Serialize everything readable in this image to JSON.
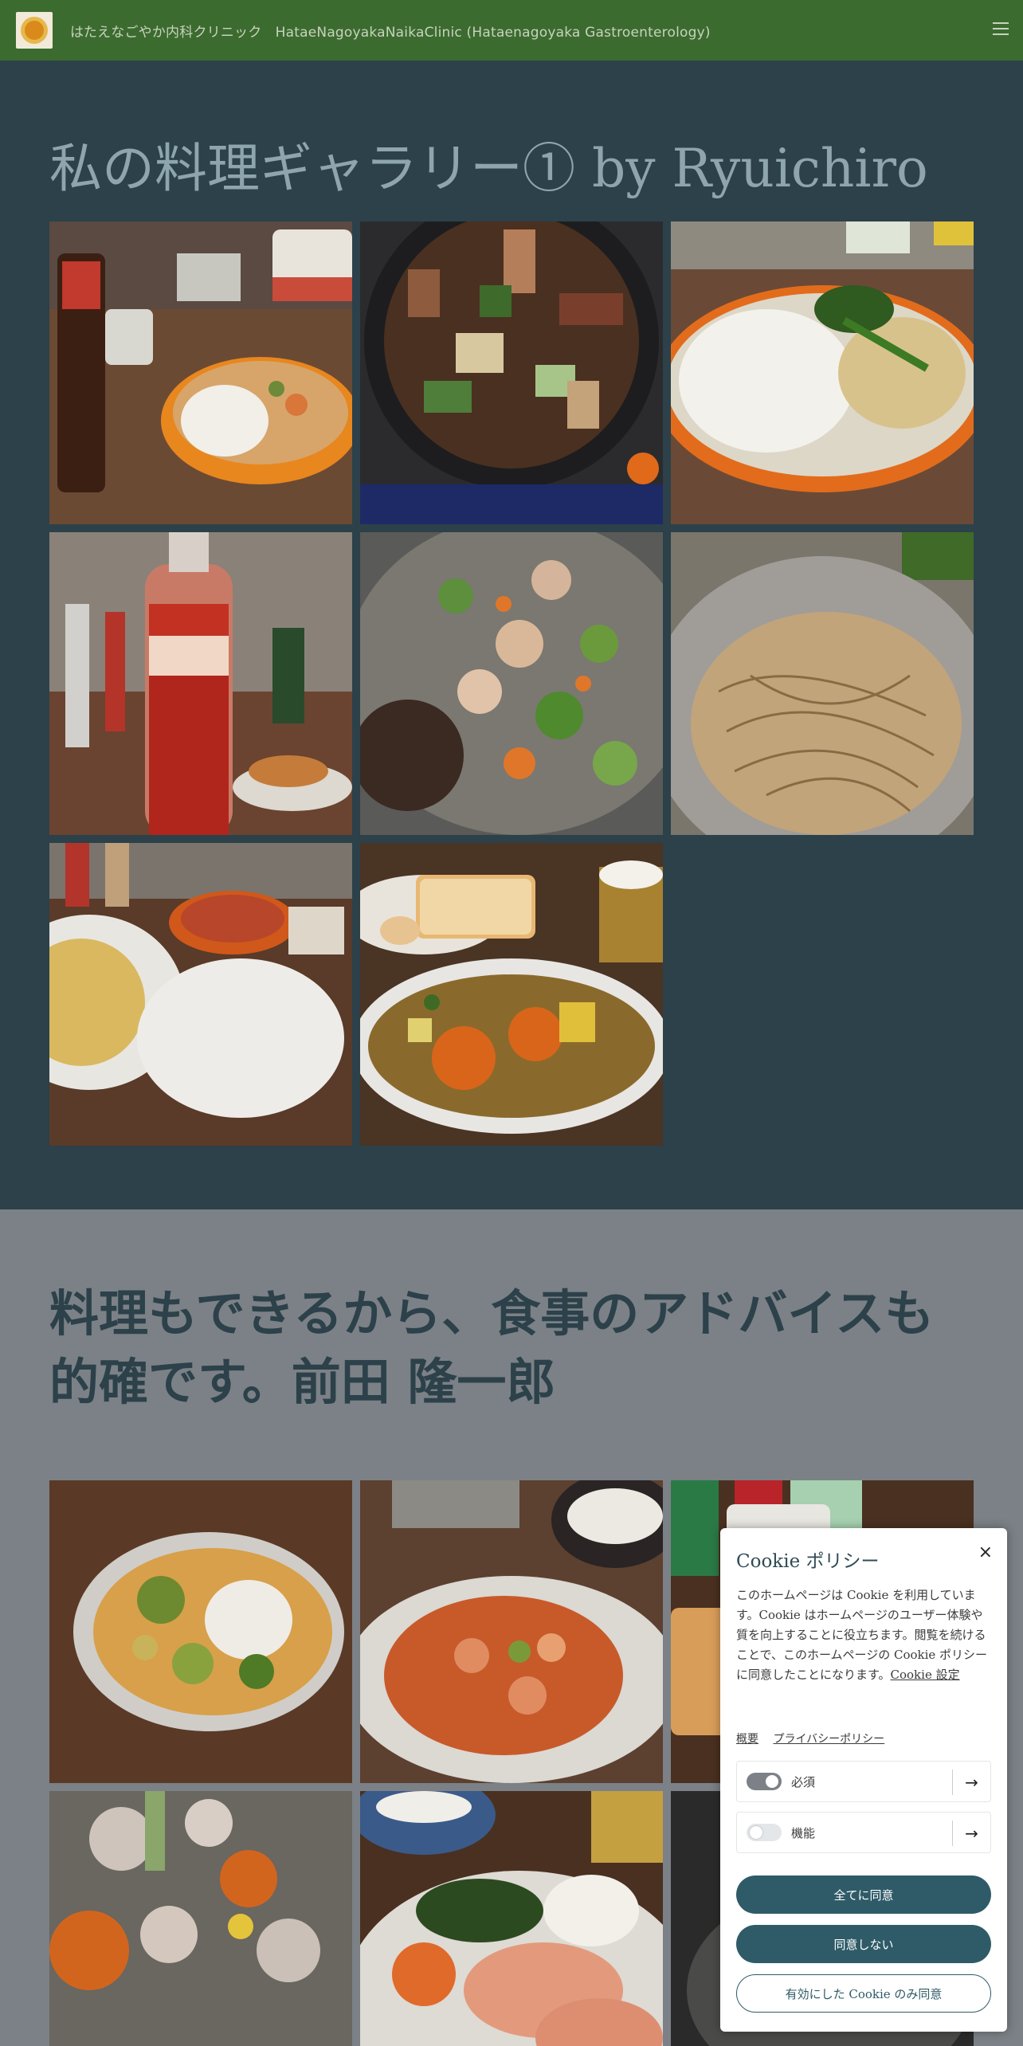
{
  "header": {
    "site_title": "はたえなごやか内科クリニック　HataeNagoyakaNaikaClinic (Hataenagoyaka Gastroenterology)"
  },
  "gallery1": {
    "title": "私の料理ギャラリー① by Ryuichiro",
    "photos": [
      {
        "icon": "photo-curry-rice-with-condiments"
      },
      {
        "icon": "photo-braised-vegetables-in-pot"
      },
      {
        "icon": "photo-rice-with-green-curry"
      },
      {
        "icon": "photo-sweet-chili-sauce-bottle"
      },
      {
        "icon": "photo-stir-fry-with-hamburg"
      },
      {
        "icon": "photo-pasta-in-bowl"
      },
      {
        "icon": "photo-spaghetti-and-curry"
      },
      {
        "icon": "photo-vegetable-curry-with-toast"
      }
    ]
  },
  "section2": {
    "title": "料理もできるから、食事のアドバイスも的確です。前田 隆一郎",
    "photos": [
      {
        "icon": "photo-green-curry-plate"
      },
      {
        "icon": "photo-shrimp-chili-plate"
      },
      {
        "icon": "photo-bread-and-drinks"
      },
      {
        "icon": "photo-pork-vegetable-stew"
      },
      {
        "icon": "photo-grilled-salmon-plate"
      },
      {
        "icon": "photo-dish-partial"
      }
    ]
  },
  "cookie": {
    "title": "Cookie ポリシー",
    "close": "×",
    "body": "このホームページは Cookie を利用しています。Cookie はホームページのユーザー体験や質を向上することに役立ちます。閲覧を続けることで、このホームページの Cookie ポリシーに同意したことになります。",
    "settings_link": "Cookie 設定",
    "links": [
      "概要",
      "プライバシーポリシー"
    ],
    "toggles": [
      {
        "label": "必須",
        "state": "on"
      },
      {
        "label": "機能",
        "state": "off"
      }
    ],
    "arrow": "→",
    "accept_all": "全てに同意",
    "reject": "同意しない",
    "accept_selected": "有効にした Cookie のみ同意"
  },
  "colors": {
    "header_bg": "#3c6b2f",
    "gallery_bg": "#2c414a",
    "section2_bg": "#7b8186",
    "button_primary": "#2f5b68"
  }
}
